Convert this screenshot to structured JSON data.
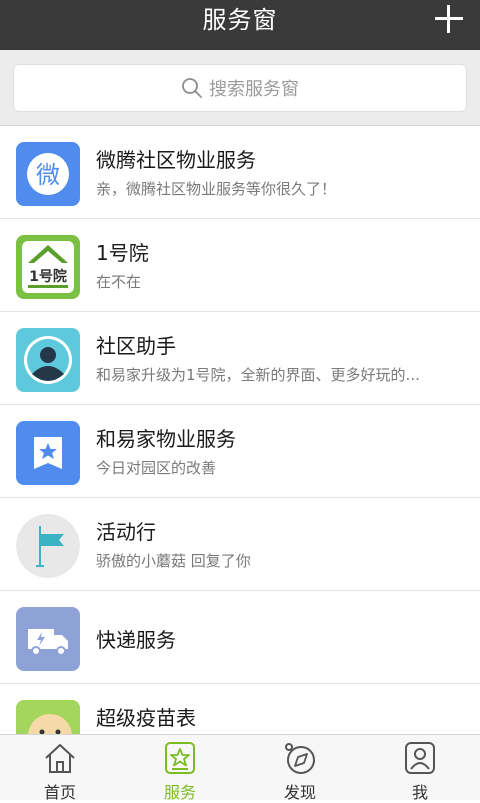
{
  "header": {
    "title": "服务窗"
  },
  "search": {
    "placeholder": "搜索服务窗"
  },
  "rows": [
    {
      "title": "微腾社区物业服务",
      "subtitle": "亲，微腾社区物业服务等你很久了！",
      "icon": "wei-logo-icon",
      "icon_text": "微"
    },
    {
      "title": "1号院",
      "subtitle": "在不在",
      "icon": "house-logo-icon",
      "icon_text": "1号院"
    },
    {
      "title": "社区助手",
      "subtitle": "和易家升级为1号院，全新的界面、更多好玩的...",
      "icon": "person-avatar-icon"
    },
    {
      "title": "和易家物业服务",
      "subtitle": "今日对园区的改善",
      "icon": "book-star-icon"
    },
    {
      "title": "活动行",
      "subtitle": "骄傲的小蘑菇 回复了你",
      "icon": "flag-icon"
    },
    {
      "title": "快递服务",
      "subtitle": "",
      "icon": "delivery-truck-icon"
    },
    {
      "title": "超级疫苗表",
      "subtitle": "",
      "icon": "baby-face-icon"
    }
  ],
  "tabs": [
    {
      "label": "首页",
      "icon": "home-icon",
      "active": false
    },
    {
      "label": "服务",
      "icon": "star-badge-icon",
      "active": true
    },
    {
      "label": "发现",
      "icon": "compass-icon",
      "active": false
    },
    {
      "label": "我",
      "icon": "profile-icon",
      "active": false
    }
  ],
  "colors": {
    "accent": "#7cbd24",
    "header_bg": "#3a3a3a"
  }
}
